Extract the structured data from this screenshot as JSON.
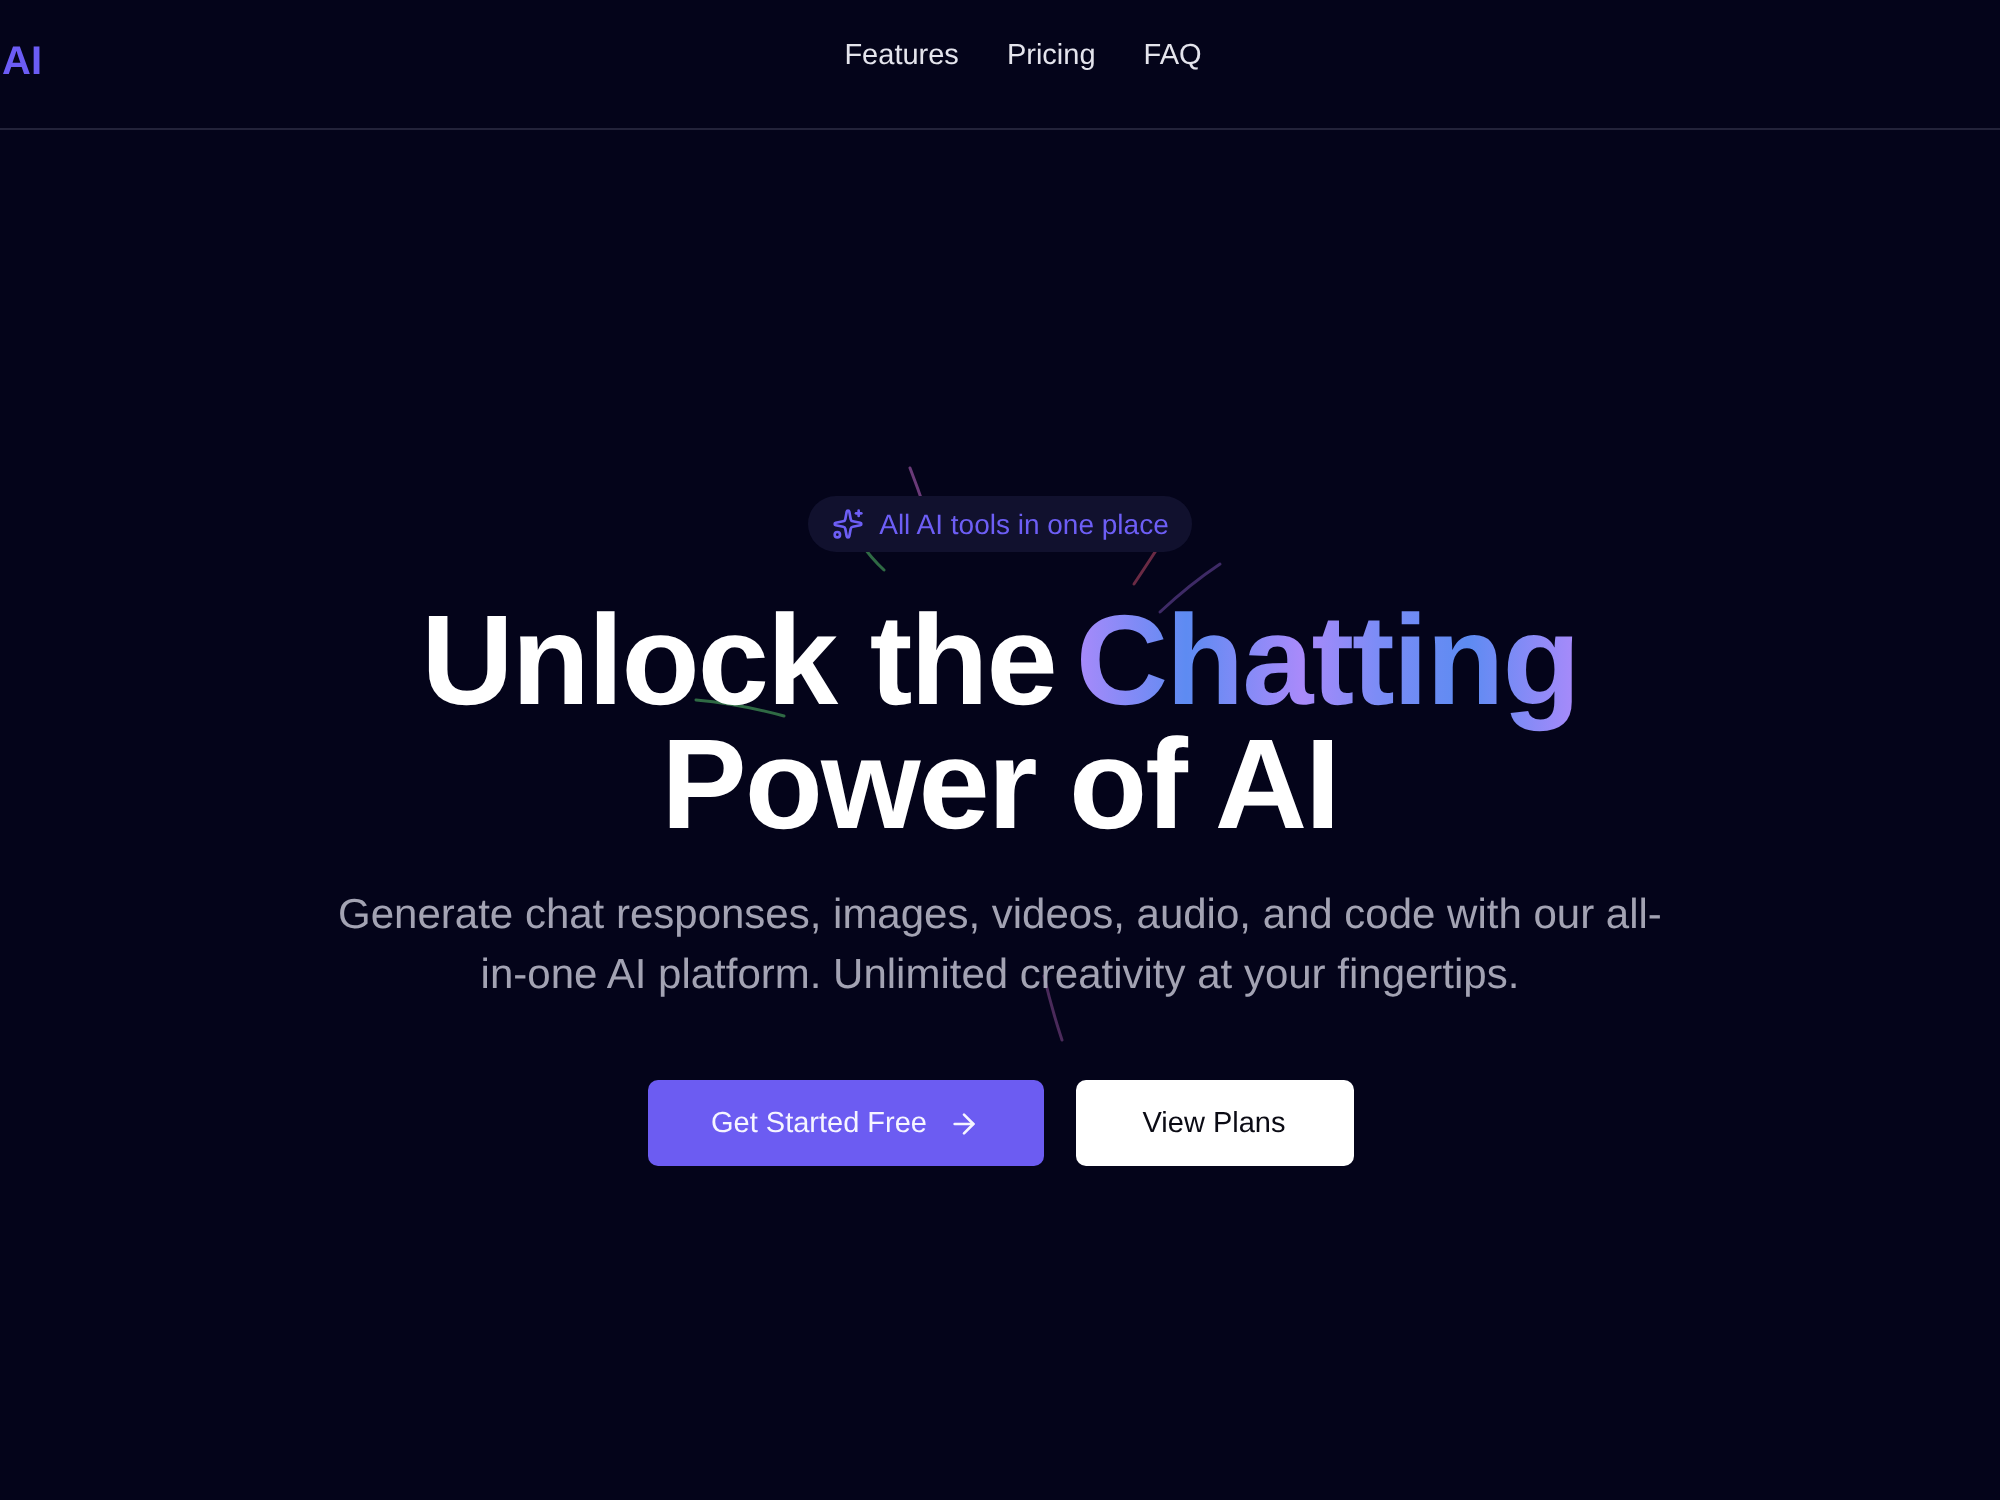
{
  "header": {
    "logo": "AI",
    "nav": [
      {
        "label": "Features"
      },
      {
        "label": "Pricing"
      },
      {
        "label": "FAQ"
      }
    ]
  },
  "hero": {
    "badge": "All AI tools in one place",
    "heading": {
      "lead": "Unlock the",
      "highlight": "Chatting",
      "tail": "Power of AI"
    },
    "subtitle": "Generate chat responses, images, videos, audio, and code with our all-in-one AI platform. Unlimited creativity at your fingertips.",
    "buttons": [
      {
        "label": "Get Started Free",
        "kind": "primary"
      },
      {
        "label": "View Plans",
        "kind": "secondary"
      }
    ]
  }
}
